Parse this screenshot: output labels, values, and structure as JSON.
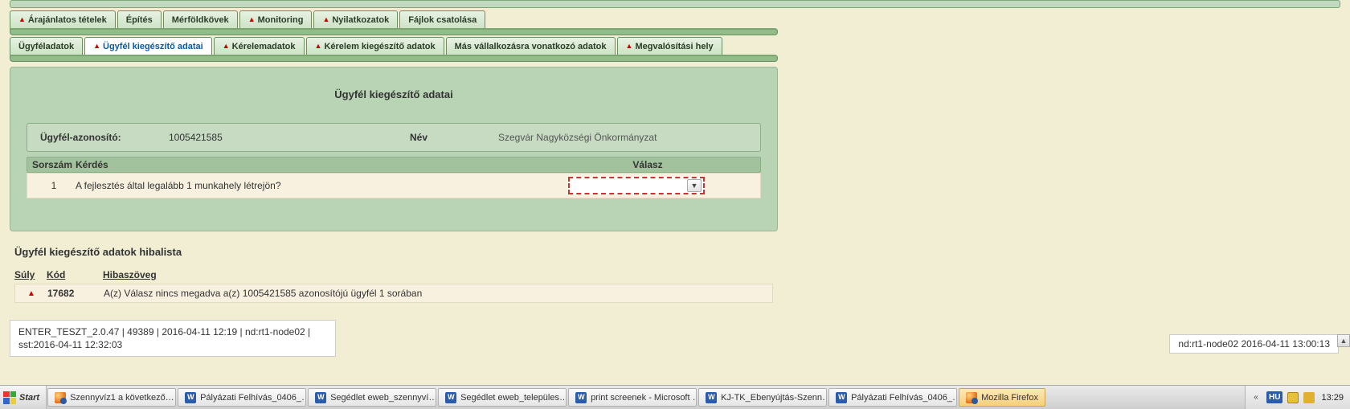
{
  "tabsRow1": [
    {
      "label": "Árajánlatos tételek",
      "warn": true
    },
    {
      "label": "Építés"
    },
    {
      "label": "Mérföldkövek"
    },
    {
      "label": "Monitoring",
      "warn": true
    },
    {
      "label": "Nyilatkozatok",
      "warn": true
    },
    {
      "label": "Fájlok csatolása"
    }
  ],
  "tabsRow2": [
    {
      "label": "Ügyféladatok"
    },
    {
      "label": "Ügyfél kiegészítő adatai",
      "warn": true,
      "active": true
    },
    {
      "label": "Kérelemadatok",
      "warn": true
    },
    {
      "label": "Kérelem kiegészítő adatok",
      "warn": true
    },
    {
      "label": "Más vállalkozásra vonatkozó adatok"
    },
    {
      "label": "Megvalósítási hely",
      "warn": true
    }
  ],
  "panel": {
    "heading": "Ügyfél kiegészítő adatai",
    "info": {
      "idLabel": "Ügyfél-azonosító:",
      "idValue": "1005421585",
      "nameLabel": "Név",
      "nameValue": "Szegvár Nagyközségi Önkormányzat"
    },
    "gridHeader": {
      "sor": "Sorszám",
      "kerdes": "Kérdés",
      "valasz": "Válasz"
    },
    "rows": [
      {
        "sor": "1",
        "kerdes": "A fejlesztés által legalább 1 munkahely létrejön?",
        "valasz": ""
      }
    ]
  },
  "errors": {
    "title": "Ügyfél kiegészítő adatok hibalista",
    "header": {
      "suly": "Súly",
      "kod": "Kód",
      "hibaszoveg": "Hibaszöveg"
    },
    "rows": [
      {
        "kod": "17682",
        "szoveg": "A(z) Válasz nincs megadva a(z) 1005421585 azonosítójú ügyfél 1 sorában"
      }
    ]
  },
  "status": {
    "left1": "ENTER_TESZT_2.0.47 | 49389 | 2016-04-11 12:19 | nd:rt1-node02 |",
    "left2": "sst:2016-04-11 12:32:03",
    "right": "nd:rt1-node02   2016-04-11 13:00:13"
  },
  "taskbar": {
    "start": "Start",
    "items": [
      {
        "label": "Szennyvíz1 a következő…",
        "icon": "ff"
      },
      {
        "label": "Pályázati Felhívás_0406_…",
        "icon": "word"
      },
      {
        "label": "Segédlet eweb_szennyví…",
        "icon": "word"
      },
      {
        "label": "Segédlet eweb_települes…",
        "icon": "word"
      },
      {
        "label": "print screenek - Microsoft …",
        "icon": "word"
      },
      {
        "label": "KJ-TK_Ebenyújtás-Szenn…",
        "icon": "word"
      },
      {
        "label": "Pályázati Felhívás_0406_…",
        "icon": "word"
      },
      {
        "label": "Mozilla Firefox",
        "icon": "ff",
        "active": true
      }
    ],
    "lang": "HU",
    "clock": "13:29"
  }
}
